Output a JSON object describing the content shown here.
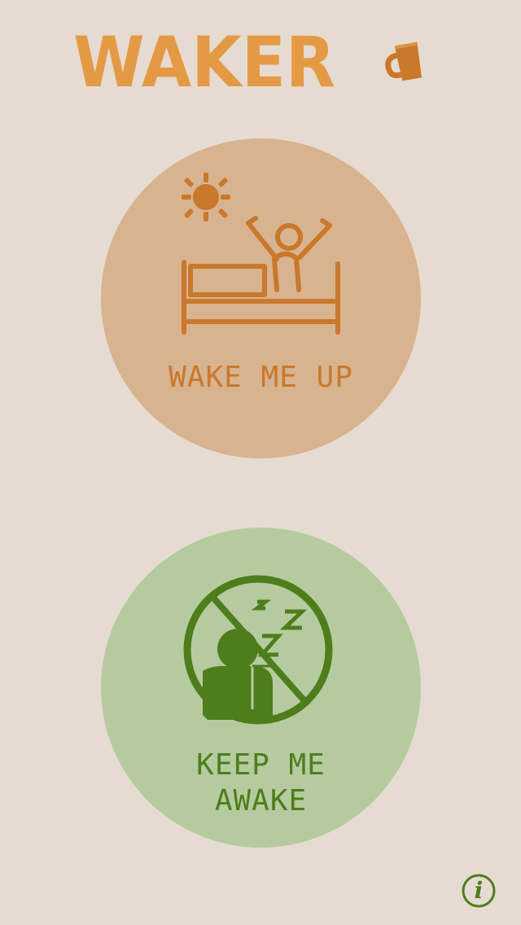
{
  "app": {
    "title": "WAKER"
  },
  "header": {
    "logo_text": "WAKER",
    "mug_icon": "coffee-mug-icon"
  },
  "wake_button": {
    "label": "WAKE ME UP",
    "icon": "waking-person-in-bed-icon",
    "sun_icon": "sun-icon"
  },
  "awake_button": {
    "label": "KEEP ME AWAKE",
    "icon": "no-sleeping-icon"
  },
  "footer": {
    "info_icon": "info-icon",
    "info_glyph": "i"
  },
  "colors": {
    "background": "#e6dbd1",
    "orange": "#e49a45",
    "brown": "#c9782c",
    "wake_circle": "#d8b38f",
    "awake_circle": "#b5cb9f",
    "green": "#4e7d1c"
  }
}
